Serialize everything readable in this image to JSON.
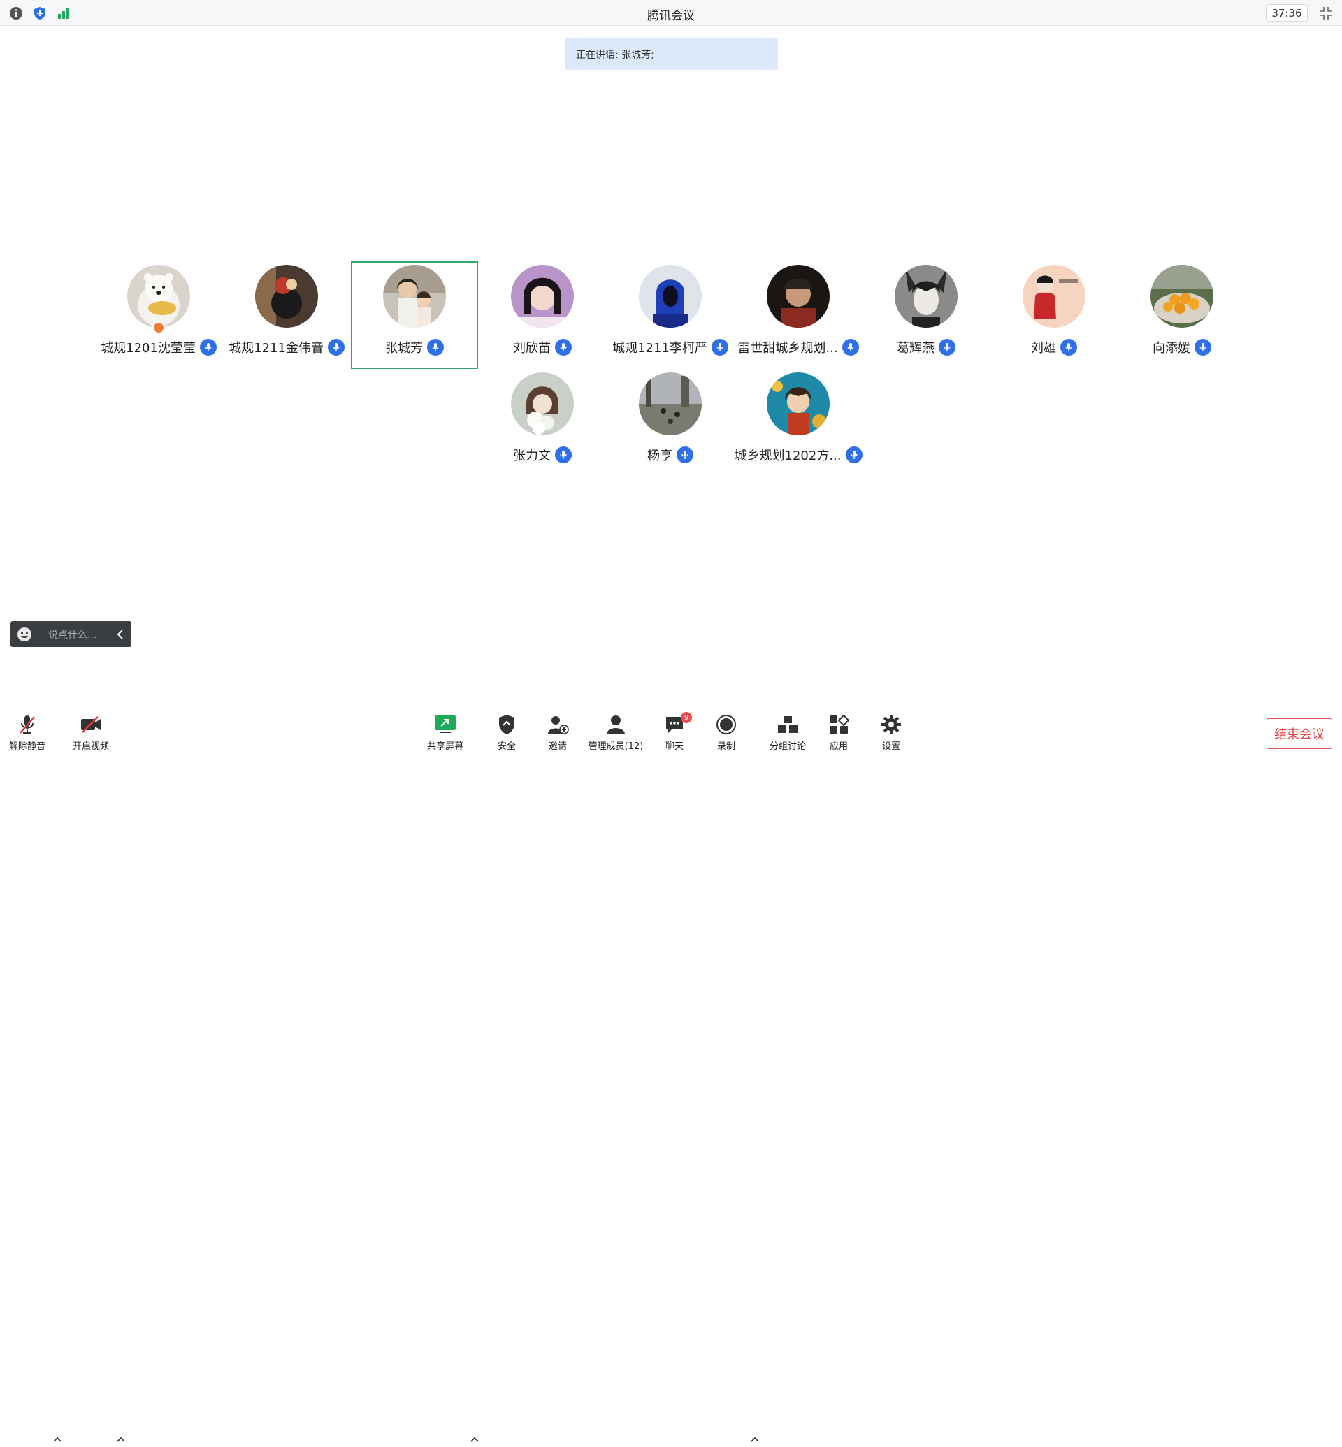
{
  "window": {
    "title": "腾讯会议",
    "timer": "37:36"
  },
  "banner": {
    "speaking_text": "正在讲话: 张城芳;"
  },
  "participants": [
    {
      "name": "城规1201沈莹莹",
      "avatar": "polar-bear-avatar",
      "host": true
    },
    {
      "name": "城规1211金伟音",
      "avatar": "dark-avatar"
    },
    {
      "name": "张城芳",
      "avatar": "mother-daughter-avatar",
      "speaking": true
    },
    {
      "name": "刘欣苗",
      "avatar": "girl-headphones-avatar"
    },
    {
      "name": "城规1211李柯严",
      "avatar": "blue-hood-avatar"
    },
    {
      "name": "雷世甜城乡规划...",
      "avatar": "dark-portrait-avatar"
    },
    {
      "name": "葛辉燕",
      "avatar": "wolf-boy-avatar"
    },
    {
      "name": "刘雄",
      "avatar": "cartoon-kid-avatar"
    },
    {
      "name": "向添媛",
      "avatar": "oranges-avatar"
    },
    {
      "name": "张力文",
      "avatar": "flower-avatar"
    },
    {
      "name": "杨亨",
      "avatar": "outdoor-avatar"
    },
    {
      "name": "城乡规划1202方...",
      "avatar": "anime-avatar"
    }
  ],
  "chat": {
    "placeholder": "说点什么..."
  },
  "toolbar": {
    "unmute": "解除静音",
    "video": "开启视频",
    "share": "共享屏幕",
    "security": "安全",
    "invite": "邀请",
    "members": "管理成员(12)",
    "chat": "聊天",
    "chat_badge": "9",
    "record": "录制",
    "breakout": "分组讨论",
    "apps": "应用",
    "settings": "设置",
    "end": "结束会议"
  },
  "colors": {
    "accent": "#2f6fe8",
    "active_border": "#2ea66b",
    "end": "#e04444",
    "banner": "#dbe9fb"
  }
}
